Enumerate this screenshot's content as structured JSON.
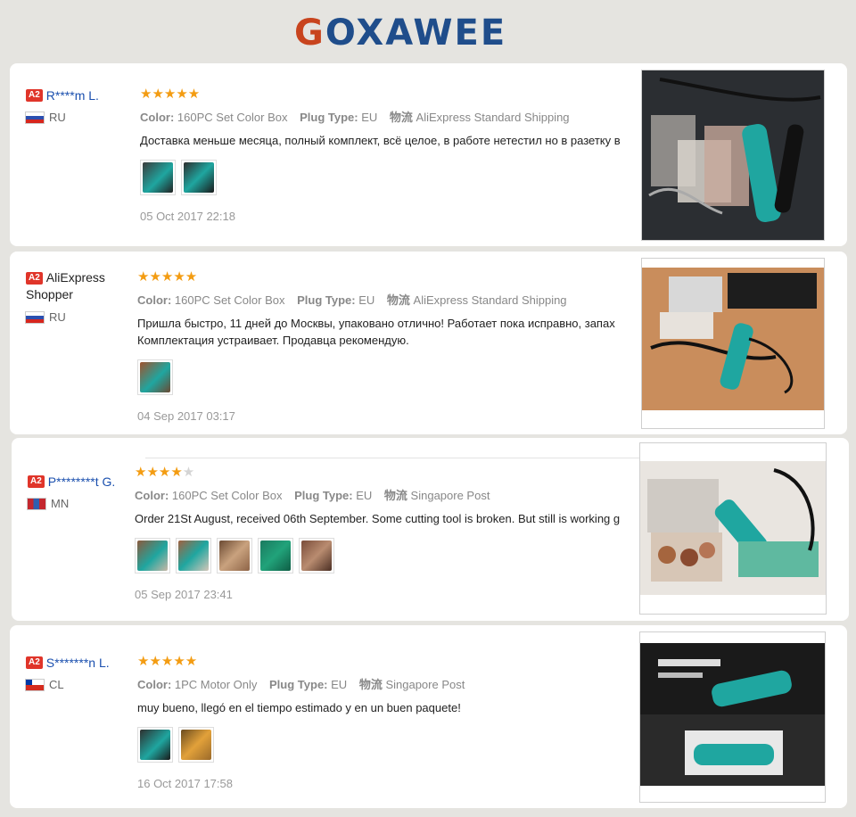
{
  "brand": {
    "logo_first": "G",
    "logo_rest": "OXAWEE"
  },
  "labels": {
    "color": "Color:",
    "plug": "Plug Type:",
    "ship_icon": "物流"
  },
  "reviews": [
    {
      "badge": "A2",
      "user": "R****m L.",
      "country": "RU",
      "stars": 5,
      "color": "160PC Set Color Box",
      "plug": "EU",
      "shipping": "AliExpress Standard Shipping",
      "text": "Доставка меньше месяца, полный комплект, всё целое, в работе нетестил но в разетку в",
      "date": "05 Oct 2017 22:18"
    },
    {
      "badge": "A2",
      "user": "AliExpress Shopper",
      "country": "RU",
      "stars": 5,
      "color": "160PC Set Color Box",
      "plug": "EU",
      "shipping": "AliExpress Standard Shipping",
      "text": "Пришла быстро, 11 дней до Москвы, упаковано отлично! Работает пока исправно, запах\nКомплектация устраивает. Продавца рекомендую.",
      "date": "04 Sep 2017 03:17"
    },
    {
      "badge": "A2",
      "user": "P********t G.",
      "country": "MN",
      "stars": 4,
      "color": "160PC Set Color Box",
      "plug": "EU",
      "shipping": "Singapore Post",
      "text": "Order 21St August, received 06th September. Some cutting tool is broken. But still is working g",
      "date": "05 Sep 2017 23:41"
    },
    {
      "badge": "A2",
      "user": "S*******n L.",
      "country": "CL",
      "stars": 5,
      "color": "1PC Motor Only",
      "plug": "EU",
      "shipping": "Singapore Post",
      "text": "muy bueno, llegó en el tiempo estimado y en un buen paquete!",
      "date": "16 Oct 2017 17:58"
    }
  ],
  "colors": {
    "star": "#f39c12",
    "star_off": "#d4d4d4",
    "name": "#1a4fae",
    "badge": "#e0352a",
    "tool": "#1fa6a0"
  }
}
